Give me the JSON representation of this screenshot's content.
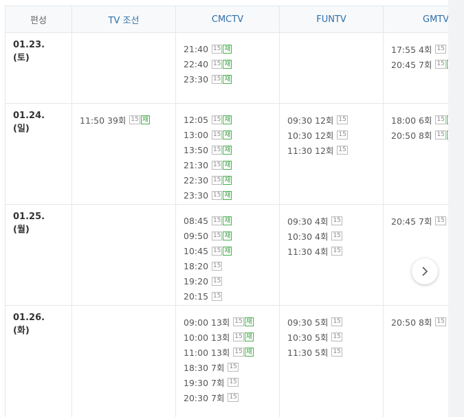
{
  "header": {
    "schedule_label": "편성",
    "channels": [
      "TV 조선",
      "CMCTV",
      "FUNTV",
      "GMTV"
    ]
  },
  "rows": [
    {
      "date": "01.23. (토)",
      "cells": [
        [],
        [
          {
            "time": "21:40",
            "rating": "15",
            "rerun": "재"
          },
          {
            "time": "22:40",
            "rating": "15",
            "rerun": "재"
          },
          {
            "time": "23:30",
            "rating": "15",
            "rerun": "재"
          }
        ],
        [],
        [
          {
            "time": "17:55 4회",
            "rating": "15",
            "rerun": ""
          },
          {
            "time": "20:45 7회",
            "rating": "15",
            "rerun": "재"
          }
        ]
      ]
    },
    {
      "date": "01.24. (일)",
      "cells": [
        [
          {
            "time": "11:50 39회",
            "rating": "15",
            "rerun": "재"
          }
        ],
        [
          {
            "time": "12:05",
            "rating": "15",
            "rerun": "재"
          },
          {
            "time": "13:00",
            "rating": "15",
            "rerun": "재"
          },
          {
            "time": "13:50",
            "rating": "15",
            "rerun": "재"
          },
          {
            "time": "21:30",
            "rating": "15",
            "rerun": "재"
          },
          {
            "time": "22:30",
            "rating": "15",
            "rerun": "재"
          },
          {
            "time": "23:30",
            "rating": "15",
            "rerun": "재"
          }
        ],
        [
          {
            "time": "09:30 12회",
            "rating": "15",
            "rerun": ""
          },
          {
            "time": "10:30 12회",
            "rating": "15",
            "rerun": ""
          },
          {
            "time": "11:30 12회",
            "rating": "15",
            "rerun": ""
          }
        ],
        [
          {
            "time": "18:00 6회",
            "rating": "15",
            "rerun": "재"
          },
          {
            "time": "20:50 8회",
            "rating": "15",
            "rerun": "재"
          }
        ]
      ]
    },
    {
      "date": "01.25. (월)",
      "cells": [
        [],
        [
          {
            "time": "08:45",
            "rating": "15",
            "rerun": "재"
          },
          {
            "time": "09:50",
            "rating": "15",
            "rerun": "재"
          },
          {
            "time": "10:45",
            "rating": "15",
            "rerun": "재"
          },
          {
            "time": "18:20",
            "rating": "15",
            "rerun": ""
          },
          {
            "time": "19:20",
            "rating": "15",
            "rerun": ""
          },
          {
            "time": "20:15",
            "rating": "15",
            "rerun": ""
          }
        ],
        [
          {
            "time": "09:30 4회",
            "rating": "15",
            "rerun": ""
          },
          {
            "time": "10:30 4회",
            "rating": "15",
            "rerun": ""
          },
          {
            "time": "11:30 4회",
            "rating": "15",
            "rerun": ""
          }
        ],
        [
          {
            "time": "20:45 7회",
            "rating": "15",
            "rerun": ""
          }
        ]
      ]
    },
    {
      "date": "01.26. (화)",
      "cells": [
        [],
        [
          {
            "time": "09:00 13회",
            "rating": "15",
            "rerun": "재"
          },
          {
            "time": "10:00 13회",
            "rating": "15",
            "rerun": "재"
          },
          {
            "time": "11:00 13회",
            "rating": "15",
            "rerun": "재"
          },
          {
            "time": "18:30 7회",
            "rating": "15",
            "rerun": ""
          },
          {
            "time": "19:30 7회",
            "rating": "15",
            "rerun": ""
          },
          {
            "time": "20:30 7회",
            "rating": "15",
            "rerun": ""
          }
        ],
        [
          {
            "time": "09:30 5회",
            "rating": "15",
            "rerun": ""
          },
          {
            "time": "10:30 5회",
            "rating": "15",
            "rerun": ""
          },
          {
            "time": "11:30 5회",
            "rating": "15",
            "rerun": ""
          }
        ],
        [
          {
            "time": "20:50 8회",
            "rating": "15",
            "rerun": ""
          }
        ]
      ]
    }
  ],
  "next_button_icon": "chevron-right-icon"
}
